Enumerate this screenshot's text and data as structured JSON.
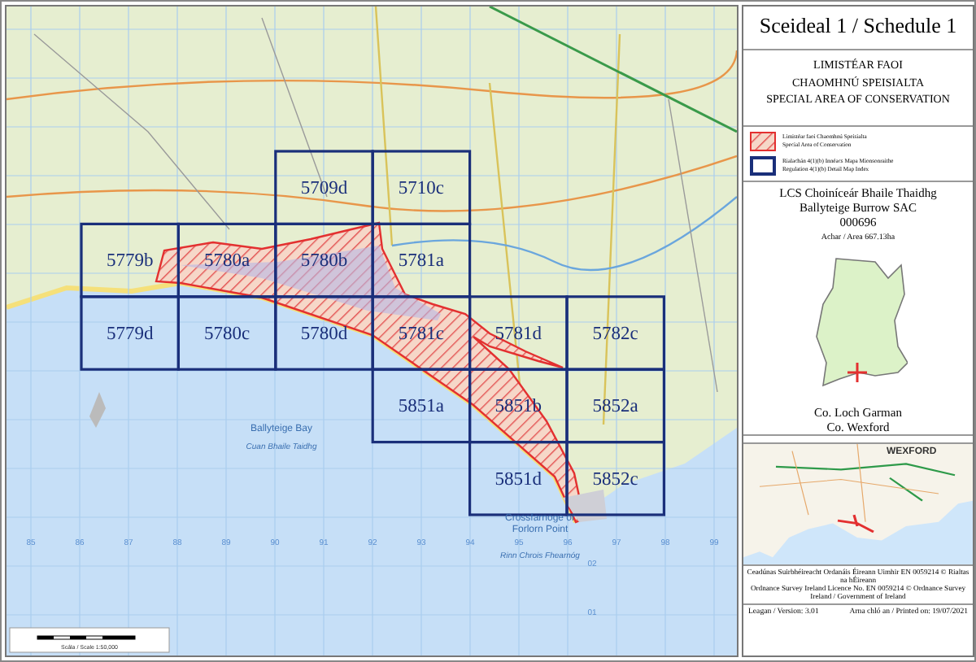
{
  "title": "Sceideal 1 / Schedule 1",
  "designation_lines": [
    "LIMISTÉAR FAOI",
    "CHAOMHNÚ SPEISIALTA",
    "SPECIAL AREA OF CONSERVATION"
  ],
  "legend": [
    {
      "kind": "sac",
      "lines": [
        "Limistéar faoi Chaomhnú Speisialta",
        "Special Area of Conservation"
      ]
    },
    {
      "kind": "detail_index",
      "lines": [
        "Rialachán 4(1)(b) Innéacs Mapa Mionsonraithe",
        "Regulation 4(1)(b) Detail Map Index"
      ]
    }
  ],
  "site": {
    "name_ga": "LCS Choiníceár Bhaile Thaidhg",
    "name_en": "Ballyteige Burrow SAC",
    "code": "000696",
    "area": "Achar / Area 667.13ha"
  },
  "county": [
    "Co. Loch Garman",
    "Co. Wexford"
  ],
  "location_map": {
    "label": "WEXFORD"
  },
  "copyright": [
    "Ceadúnas Suirbhéireacht Ordanáis Éireann Uimhir EN 0059214 © Rialtas na hÉireann",
    "Ordnance Survey Ireland Licence No. EN 0059214 © Ordnance Survey Ireland / Government of Ireland"
  ],
  "version": "Leagan / Version: 3.01",
  "printed": "Arna chló an / Printed on: 19/07/2021",
  "map": {
    "tiles": [
      "5709d",
      "5710c",
      "5779b",
      "5780a",
      "5780b",
      "5781a",
      "5779d",
      "5780c",
      "5780d",
      "5781c",
      "5781d",
      "5782c",
      "5851a",
      "5851b",
      "5852a",
      "5851d",
      "5852c"
    ],
    "place_labels": [
      {
        "kind": "name",
        "text": "Ballyteige Bay"
      },
      {
        "kind": "irish_name",
        "text": "Cuan Bhaile Taidhg"
      },
      {
        "kind": "name",
        "text": "Crossfarnoge or"
      },
      {
        "kind": "name",
        "text": "Forlorn Point"
      },
      {
        "kind": "irish_name",
        "text": "Rinn Chrois Fhearnóg"
      }
    ],
    "grid_numbers": [
      "85",
      "86",
      "87",
      "88",
      "89",
      "90",
      "91",
      "92",
      "93",
      "94",
      "95",
      "96",
      "97",
      "98",
      "99"
    ],
    "northing_numbers": [
      "02",
      "01"
    ],
    "scale": "Scála / Scale 1:50,000"
  }
}
